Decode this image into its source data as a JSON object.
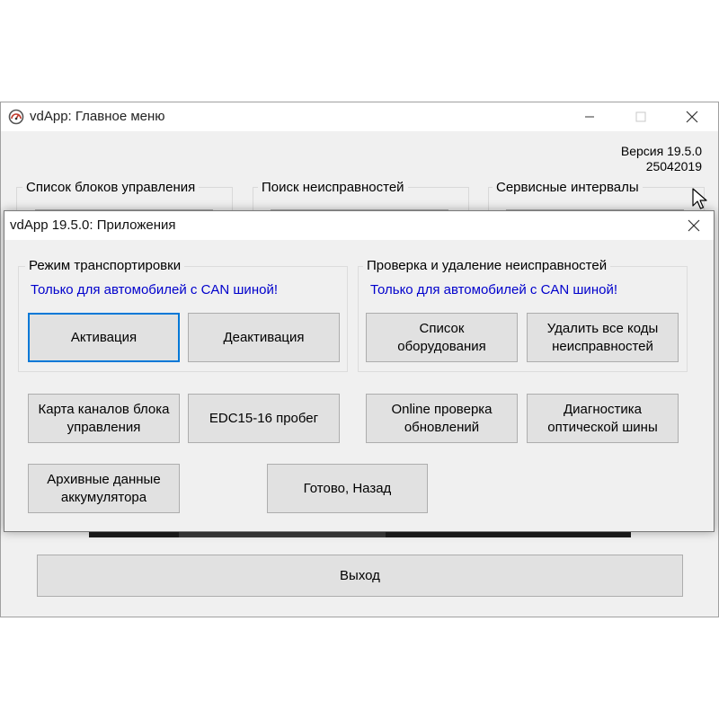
{
  "main_window": {
    "title": "vdApp:  Главное меню",
    "version_line": "Версия 19.5.0",
    "build_line": "25042019",
    "sections": [
      {
        "label": "Список блоков управления"
      },
      {
        "label": "Поиск неисправностей"
      },
      {
        "label": "Сервисные интервалы"
      }
    ],
    "exit_button": "Выход"
  },
  "dialog": {
    "title": "vdApp 19.5.0:  Приложения",
    "transport_group": {
      "label": "Режим транспортировки",
      "note": "Только для автомобилей с CAN шиной!",
      "activate": "Активация",
      "deactivate": "Деактивация"
    },
    "faults_group": {
      "label": "Проверка и удаление неисправностей",
      "note": "Только для автомобилей с CAN шиной!",
      "equipment_line1": "Список",
      "equipment_line2": "оборудования",
      "clear_codes_line1": "Удалить все коды",
      "clear_codes_line2": "неисправностей"
    },
    "channel_map_line1": "Карта каналов блока",
    "channel_map_line2": "управления",
    "edc_mileage": "EDC15-16 пробег",
    "online_check_line1": "Online проверка",
    "online_check_line2": "обновлений",
    "optical_bus_line1": "Диагностика",
    "optical_bus_line2": "оптической шины",
    "battery_archive_line1": "Архивные данные",
    "battery_archive_line2": "аккумулятора",
    "done_back": "Готово, Назад"
  },
  "icons": {
    "app": "speedometer-icon",
    "minimize": "minimize-icon",
    "maximize": "maximize-icon",
    "close": "close-icon",
    "cursor": "mouse-cursor-icon"
  },
  "colors": {
    "note_text": "#0000cc",
    "focus_border": "#0078d7",
    "window_bg": "#f0f0f0",
    "button_bg": "#e1e1e1"
  }
}
